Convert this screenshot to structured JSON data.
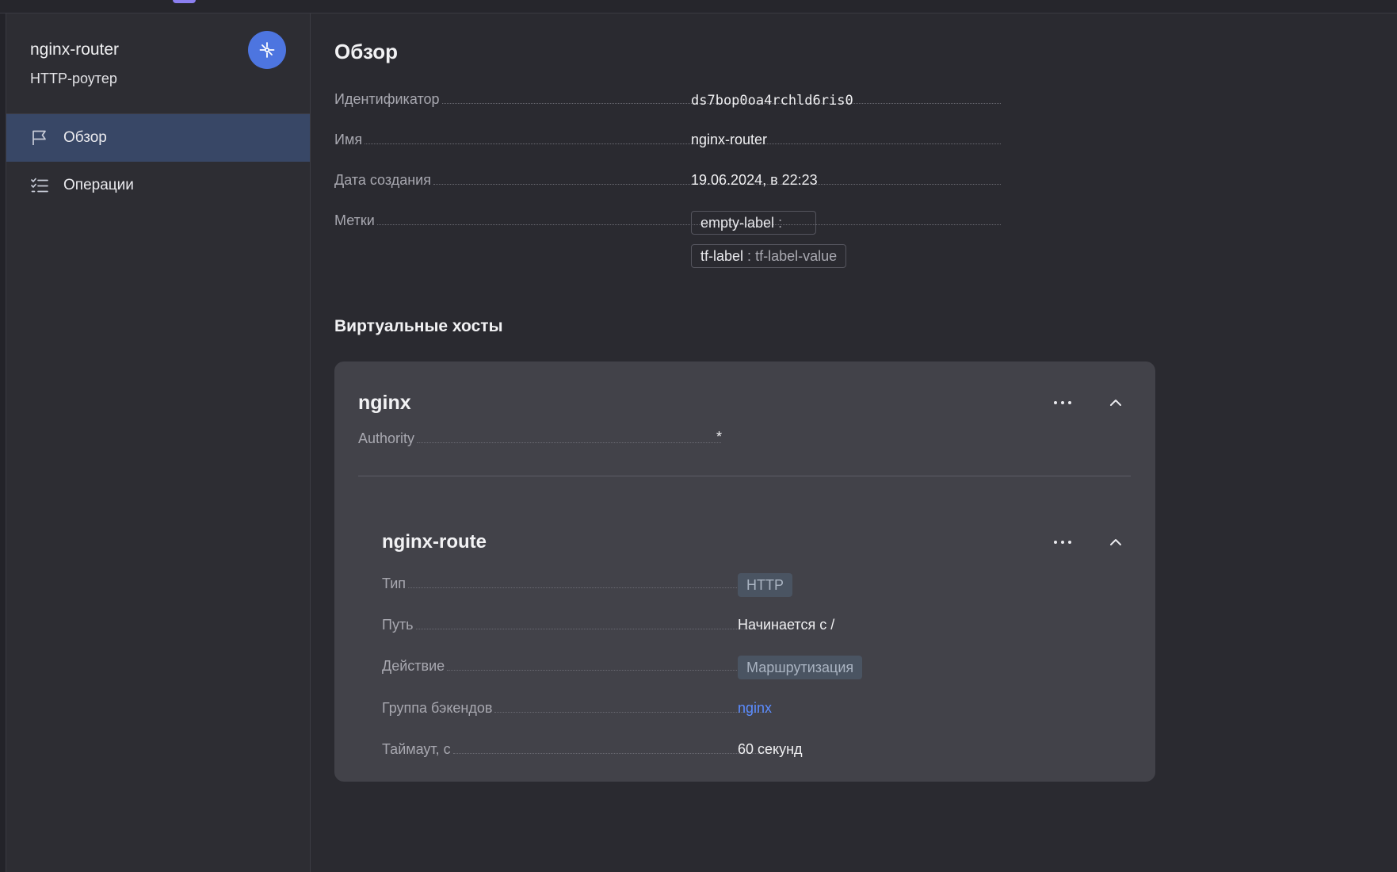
{
  "sidebar": {
    "title": "nginx-router",
    "subtitle": "HTTP-роутер",
    "nav": [
      {
        "label": "Обзор",
        "icon": "flag-icon",
        "active": true
      },
      {
        "label": "Операции",
        "icon": "checklist-icon",
        "active": false
      }
    ]
  },
  "overview": {
    "title": "Обзор",
    "fields": {
      "id_label": "Идентификатор",
      "id_value": "ds7bop0oa4rchld6ris0",
      "name_label": "Имя",
      "name_value": "nginx-router",
      "created_label": "Дата создания",
      "created_value": "19.06.2024, в 22:23",
      "labels_label": "Метки"
    },
    "labels": [
      {
        "key": "empty-label",
        "sep": ":",
        "value": ""
      },
      {
        "key": "tf-label",
        "sep": ":",
        "value": "tf-label-value"
      }
    ]
  },
  "virtual_hosts": {
    "title": "Виртуальные хосты",
    "host": {
      "name": "nginx",
      "authority_label": "Authority",
      "authority_value": "*",
      "route": {
        "name": "nginx-route",
        "type_label": "Тип",
        "type_value": "HTTP",
        "path_label": "Путь",
        "path_value": "Начинается с /",
        "action_label": "Действие",
        "action_value": "Маршрутизация",
        "backend_label": "Группа бэкендов",
        "backend_value": "nginx",
        "timeout_label": "Таймаут, с",
        "timeout_value": "60 секунд"
      }
    }
  },
  "colors": {
    "accent": "#4d75e0",
    "link": "#5b8cff",
    "active_nav": "#384766",
    "card_bg": "#424249"
  }
}
